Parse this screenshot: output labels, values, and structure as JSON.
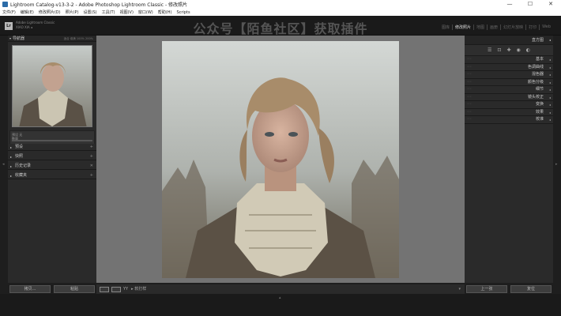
{
  "window": {
    "title": "Lightroom Catalog-v13-3-2 - Adobe Photoshop Lightroom Classic - 修改照片",
    "minimize": "—",
    "maximize": "☐",
    "close": "✕"
  },
  "menu": [
    "文件(F)",
    "编辑(E)",
    "修改照片(D)",
    "照片(P)",
    "设置(S)",
    "工具(T)",
    "视图(V)",
    "窗口(W)",
    "帮助(H)",
    "Scripts"
  ],
  "identity": {
    "logo": "Lr",
    "line1": "Adobe Lightroom Classic",
    "line2": "XIAO XIA ◂",
    "watermark": "公众号【陌鱼社区】获取插件"
  },
  "modules": [
    "图库",
    "修改照片",
    "地图",
    "画册",
    "幻灯片放映",
    "打印",
    "Web"
  ],
  "active_module": "修改照片",
  "left_panel": {
    "navigator_label": "导航器",
    "navigator_options": "适合  填满  100%  200%",
    "histo_line1": "预设   无",
    "histo_line2": "数量",
    "sections": [
      "预设",
      "快照",
      "历史记录",
      "收藏夹"
    ],
    "copy_button": "拷贝...",
    "paste_button": "粘贴"
  },
  "toolbar": {
    "view_btn": "",
    "compare_btn": "",
    "ref_btn": "YY",
    "soft_proof": "▸ 软打样"
  },
  "right_panel": {
    "histogram_label": "直方图",
    "sections": [
      "基本",
      "色调曲线",
      "混色器",
      "颜色分级",
      "细节",
      "镜头校正",
      "变换",
      "效果",
      "校准"
    ],
    "prev_button": "上一张",
    "reset_button": "复位"
  },
  "colors": {
    "accent": "#e0e0e0",
    "panel_bg": "#2a2a2a",
    "canvas_bg": "#737373"
  }
}
